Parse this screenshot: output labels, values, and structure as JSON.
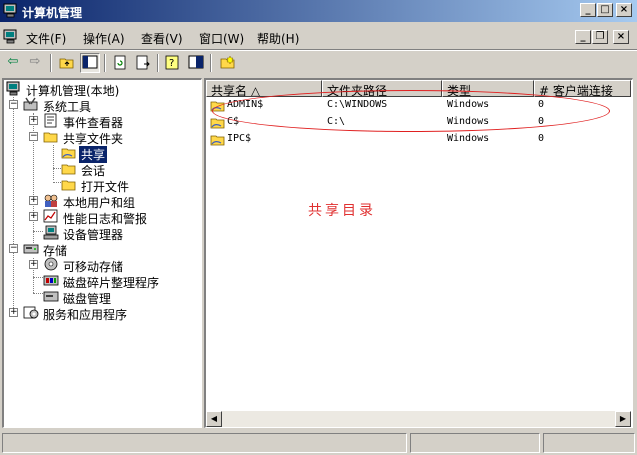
{
  "window": {
    "title": "计算机管理"
  },
  "menu": [
    {
      "label": "文件(F)"
    },
    {
      "label": "操作(A)"
    },
    {
      "label": "查看(V)"
    },
    {
      "label": "窗口(W)"
    },
    {
      "label": "帮助(H)"
    }
  ],
  "tree": {
    "root": "计算机管理(本地)",
    "system_tools": "系统工具",
    "event_viewer": "事件查看器",
    "shared_folders": "共享文件夹",
    "shares": "共享",
    "sessions": "会话",
    "open_files": "打开文件",
    "local_users": "本地用户和组",
    "perf_logs": "性能日志和警报",
    "device_manager": "设备管理器",
    "storage": "存储",
    "removable_storage": "可移动存储",
    "defrag": "磁盘碎片整理程序",
    "disk_mgmt": "磁盘管理",
    "services_apps": "服务和应用程序"
  },
  "list": {
    "columns": [
      "共享名 △",
      "文件夹路径",
      "类型",
      "# 客户端连接"
    ],
    "rows": [
      {
        "name": "ADMIN$",
        "path": "C:\\WINDOWS",
        "type": "Windows",
        "clients": "0"
      },
      {
        "name": "C$",
        "path": "C:\\",
        "type": "Windows",
        "clients": "0"
      },
      {
        "name": "IPC$",
        "path": "",
        "type": "Windows",
        "clients": "0"
      }
    ]
  },
  "annotation": {
    "text": "共享目录",
    "color": "#e03030"
  },
  "colors": {
    "titlebar": "#0a246a",
    "face": "#d4d0c8",
    "selection": "#0a246a"
  }
}
